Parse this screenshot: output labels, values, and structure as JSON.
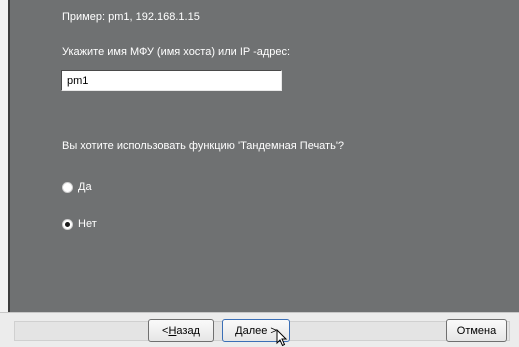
{
  "main": {
    "hint": "Пример: pm1, 192.168.1.15",
    "prompt": "Укажите имя МФУ (имя хоста) или IP -адрес:",
    "host_value": "pm1",
    "question": "Вы хотите использовать функцию 'Тандемная Печать'?",
    "radio_yes": "Да",
    "radio_no": "Нет",
    "selected": "Нет"
  },
  "buttons": {
    "back_prefix": "< ",
    "back_mnemonic": "Н",
    "back_rest": "азад",
    "next_mnemonic": "Д",
    "next_rest": "алее >",
    "cancel": "Отмена"
  },
  "colors": {
    "panel": "#6f7172",
    "text": "#ffffff",
    "footer": "#ececec"
  }
}
